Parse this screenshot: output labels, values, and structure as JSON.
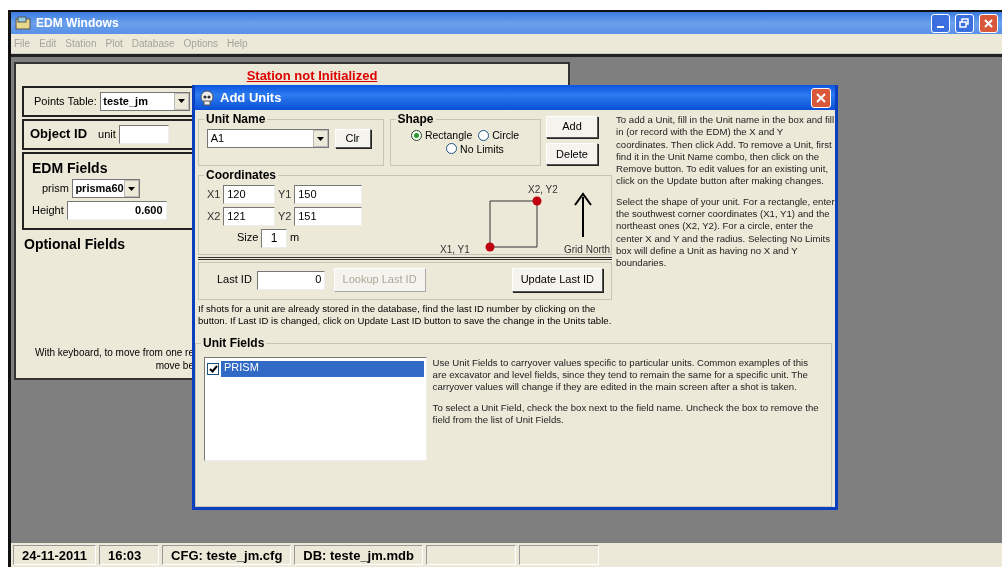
{
  "main_window": {
    "title": "EDM Windows",
    "menu": [
      {
        "label": "File"
      },
      {
        "label": "Edit"
      },
      {
        "label": "Station"
      },
      {
        "label": "Plot"
      },
      {
        "label": "Database"
      },
      {
        "label": "Options"
      },
      {
        "label": "Help"
      }
    ]
  },
  "main_form": {
    "status_message": "Station not Initialized",
    "points_table": {
      "label": "Points Table:",
      "value": "teste_jm"
    },
    "object_id": {
      "title": "Object ID",
      "label": "unit"
    },
    "edm_fields": {
      "title": "EDM Fields",
      "prism": {
        "label": "prism",
        "value": "prisma60"
      },
      "height": {
        "label": "Height",
        "value": "0.600"
      }
    },
    "optional_fields": {
      "title": "Optional Fields"
    },
    "keyboard_hint": [
      "With keyboard, to move from one re",
      "move be"
    ]
  },
  "dialog": {
    "title": "Add Units",
    "unit_name": {
      "title": "Unit Name",
      "value": "A1",
      "clear_button": "Clr"
    },
    "shape": {
      "title": "Shape",
      "options": [
        {
          "label": "Rectangle",
          "selected": true
        },
        {
          "label": "Circle",
          "selected": false
        },
        {
          "label": "No Limits",
          "selected": false
        }
      ]
    },
    "buttons": [
      {
        "label": "Add"
      },
      {
        "label": "Delete"
      }
    ],
    "coordinates": {
      "title": "Coordinates",
      "fields": [
        {
          "label": "X1",
          "value": "120"
        },
        {
          "label": "Y1",
          "value": "150"
        },
        {
          "label": "X2",
          "value": "121"
        },
        {
          "label": "Y2",
          "value": "151"
        }
      ],
      "size": {
        "label": "Size",
        "value": "1",
        "unit": "m"
      },
      "diagram": {
        "corner_ne": "X2, Y2",
        "corner_sw": "X1, Y1",
        "north": "Grid North"
      }
    },
    "last_id": {
      "label": "Last ID",
      "value": "0",
      "buttons": [
        {
          "label": "Lookup Last ID",
          "disabled": true
        },
        {
          "label": "Update Last ID",
          "disabled": false
        }
      ]
    },
    "last_id_help": "If shots for a unit are already stored in the database, find the last ID number by clicking on the button. If Last ID is changed, click on Update Last ID button to save the change in the Units table.",
    "help": [
      "To add a Unit, fill in the Unit name in the box and fill in (or record with the EDM) the X and Y coordinates.  Then click Add.  To remove a Unit, first find it in the Unit Name combo, then click on the Remove button.  To edit values for an existing unit, click on the Update button after making changes.",
      "Select the shape of your unit.  For a rectangle, enter the southwest corner coordinates (X1, Y1) and the northeast ones (X2, Y2).  For a circle, enter the center X and Y and the radius.  Selecting No Limits box will define a Unit as having no X and Y boundaries."
    ],
    "unit_fields": {
      "title": "Unit Fields",
      "items": [
        {
          "label": "PRISM",
          "checked": true,
          "selected": true
        }
      ],
      "help": [
        "Use Unit Fields to carryover values specific to particular units.  Common examples of this are excavator and level fields, since they tend to remain the same for a specific unit.  The carryover values will change if they are edited in the main screen after a shot is taken.",
        "To select a Unit Field, check the box next to the field name.  Uncheck the box to remove the field from the list of Unit Fields."
      ]
    }
  },
  "status_bar": [
    {
      "text": "24-11-2011"
    },
    {
      "text": "16:03"
    },
    {
      "text": "CFG: teste_jm.cfg"
    },
    {
      "text": "DB: teste_jm.mdb"
    }
  ]
}
